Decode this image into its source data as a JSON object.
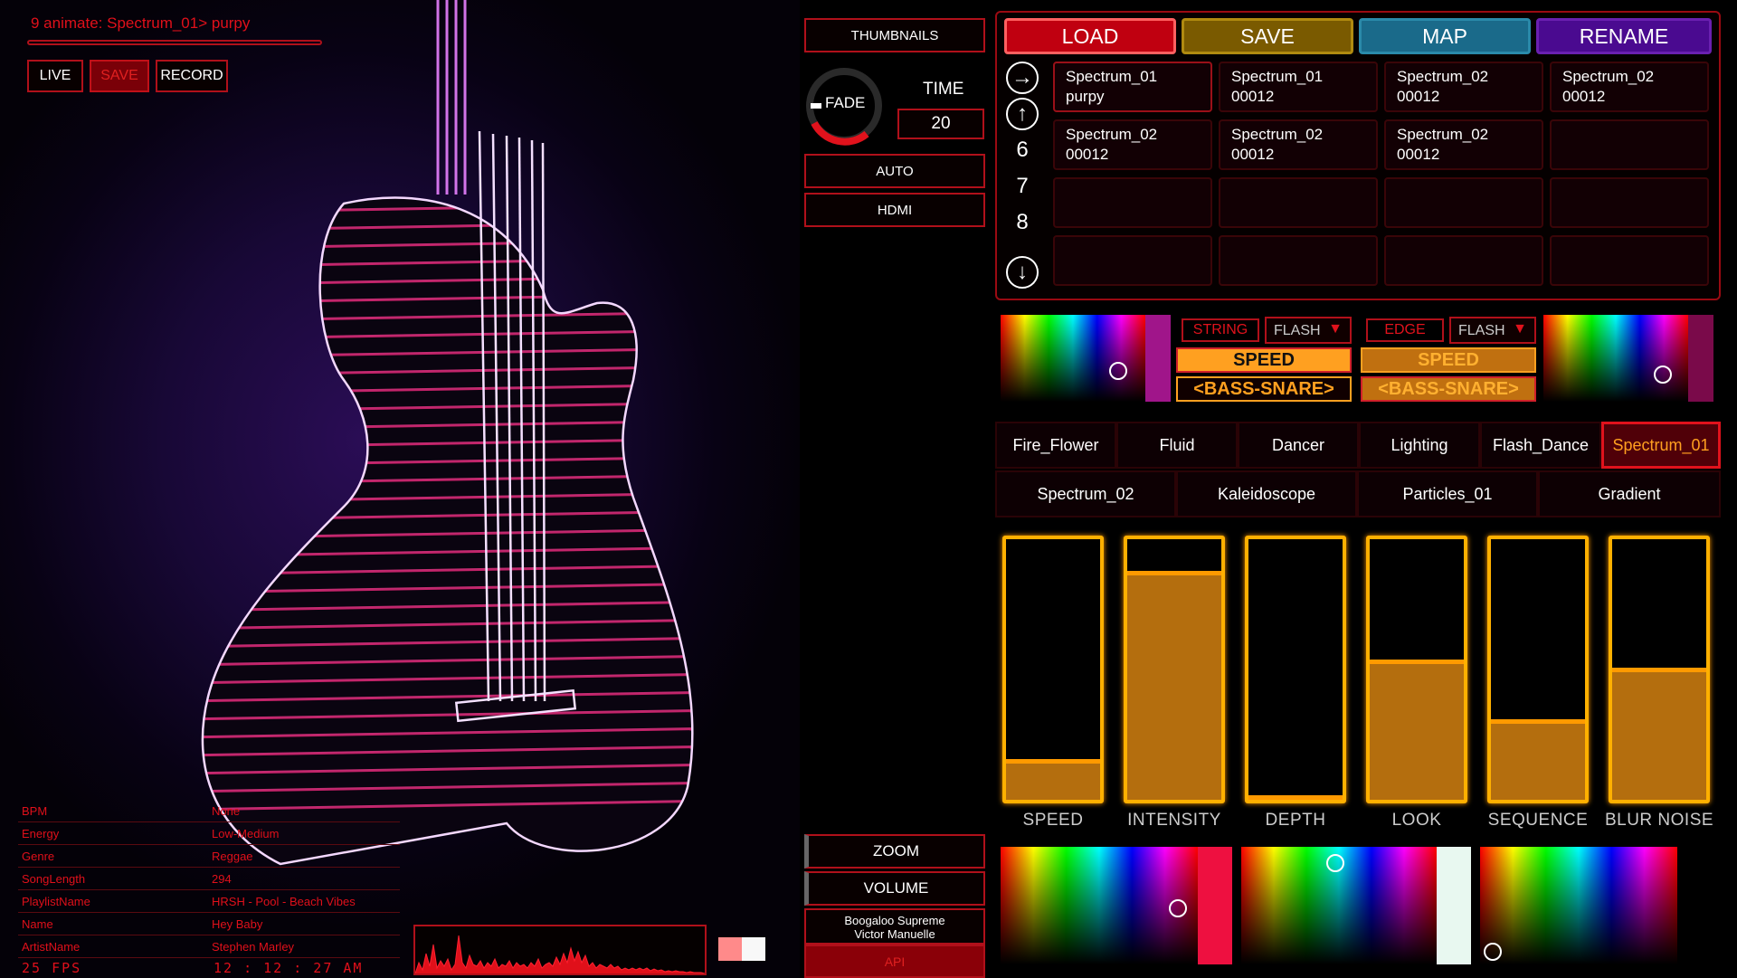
{
  "header": {
    "title": "9 animate: Spectrum_01> purpy"
  },
  "top_buttons": {
    "live": "LIVE",
    "save": "SAVE",
    "record": "RECORD"
  },
  "control": {
    "thumbnails": "THUMBNAILS",
    "fade": "FADE",
    "time_label": "TIME",
    "time_value": "20",
    "auto": "AUTO",
    "hdmi": "HDMI",
    "zoom": "ZOOM",
    "volume": "VOLUME",
    "song_line1": "Boogaloo Supreme",
    "song_line2": "Victor Manuelle",
    "api": "API"
  },
  "actions": {
    "load": "LOAD",
    "save": "SAVE",
    "map": "MAP",
    "rename": "RENAME"
  },
  "pager": {
    "n1": "6",
    "n2": "7",
    "n3": "8"
  },
  "presets": [
    {
      "l1": "Spectrum_01",
      "l2": "purpy"
    },
    {
      "l1": "Spectrum_01",
      "l2": "00012"
    },
    {
      "l1": "Spectrum_02",
      "l2": "00012"
    },
    {
      "l1": "Spectrum_02",
      "l2": "00012"
    },
    {
      "l1": "Spectrum_02",
      "l2": "00012"
    },
    {
      "l1": "Spectrum_02",
      "l2": "00012"
    },
    {
      "l1": "Spectrum_02",
      "l2": "00012"
    }
  ],
  "color_controls": {
    "string_label": "STRING",
    "edge_label": "EDGE",
    "flash_left": "FLASH",
    "flash_right": "FLASH",
    "speed_left": "SPEED",
    "speed_right": "SPEED",
    "bass_left": "<BASS-SNARE>",
    "bass_right": "<BASS-SNARE>"
  },
  "effects_row1": [
    "Fire_Flower",
    "Fluid",
    "Dancer",
    "Lighting",
    "Flash_Dance",
    "Spectrum_01"
  ],
  "effects_row2": [
    "Spectrum_02",
    "Kaleidoscope",
    "Particles_01",
    "Gradient"
  ],
  "sliders": [
    {
      "label": "SPEED",
      "level": 0.14
    },
    {
      "label": "INTENSITY",
      "level": 0.86
    },
    {
      "label": "DEPTH",
      "level": 0.0
    },
    {
      "label": "LOOK",
      "level": 0.52
    },
    {
      "label": "SEQUENCE",
      "level": 0.29
    },
    {
      "label": "BLUR NOISE",
      "level": 0.49
    }
  ],
  "info": [
    {
      "key": "BPM",
      "value": "None"
    },
    {
      "key": "Energy",
      "value": "Low-Medium"
    },
    {
      "key": "Genre",
      "value": "Reggae"
    },
    {
      "key": "SongLength",
      "value": "294"
    },
    {
      "key": "PlaylistName",
      "value": "HRSH - Pool - Beach Vibes"
    },
    {
      "key": "Name",
      "value": "Hey Baby"
    },
    {
      "key": "ArtistName",
      "value": "Stephen Marley"
    }
  ],
  "status": {
    "fps": "25 FPS",
    "clock": "12 : 12 : 27 AM"
  },
  "colors": {
    "accent_red": "#e0121c",
    "accent_orange": "#ffa020",
    "string_color": "#a0158a",
    "edge_color": "#7a0a4a",
    "swatch_red": "#ee1040",
    "swatch_white": "#e8f8f0"
  }
}
